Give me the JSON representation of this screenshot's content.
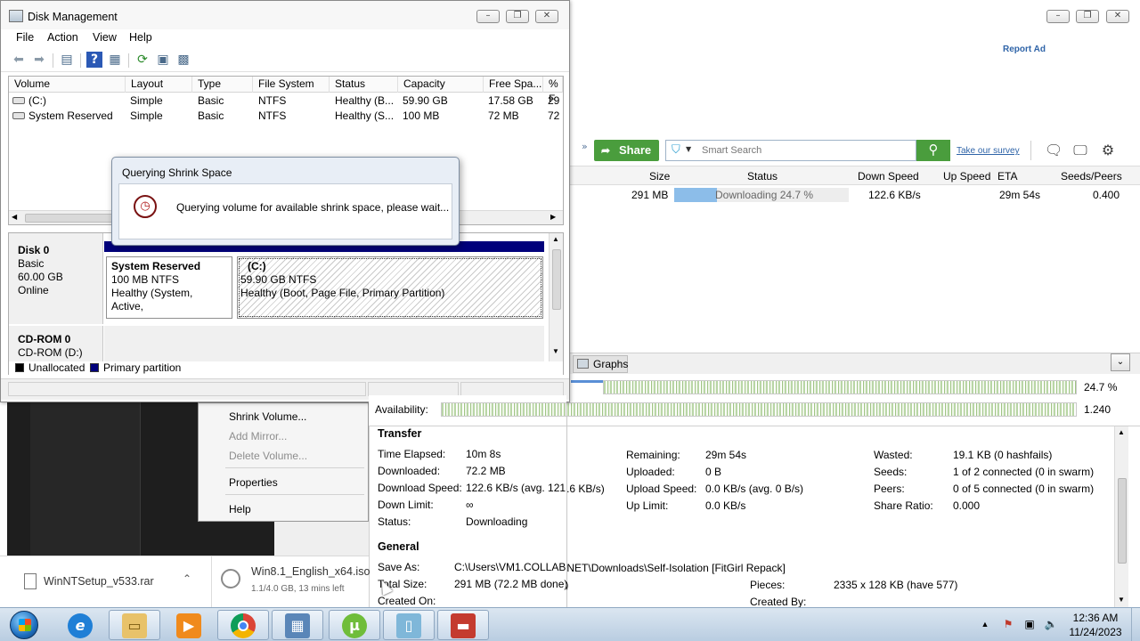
{
  "utorrent": {
    "report_ad": "Report Ad",
    "share_label": "Share",
    "search_placeholder": "Smart Search",
    "survey_link": "Take our survey",
    "columns": {
      "size": "Size",
      "status": "Status",
      "down_speed": "Down Speed",
      "up_speed": "Up Speed",
      "eta": "ETA",
      "seeds_peers": "Seeds/Peers"
    },
    "torrent": {
      "size": "291 MB",
      "status": "Downloading 24.7 %",
      "progress": 0.247,
      "down_speed": "122.6 KB/s",
      "eta": "29m 54s",
      "seeds_peers": "0.400"
    },
    "graphs_tab": "Graphs",
    "piece_percent": "24.7 %",
    "availability_label": "Availability:",
    "availability_value": "1.240",
    "transfer": {
      "heading": "Transfer",
      "time_elapsed_label": "Time Elapsed:",
      "time_elapsed": "10m 8s",
      "downloaded_label": "Downloaded:",
      "downloaded": "72.2 MB",
      "download_speed_label": "Download Speed:",
      "download_speed": "122.6 KB/s (avg. 121.6 KB/s)",
      "down_limit_label": "Down Limit:",
      "down_limit": "∞",
      "status_label": "Status:",
      "status": "Downloading",
      "remaining_label": "Remaining:",
      "remaining": "29m 54s",
      "uploaded_label": "Uploaded:",
      "uploaded": "0 B",
      "upload_speed_label": "Upload Speed:",
      "upload_speed": "0.0 KB/s (avg. 0 B/s)",
      "up_limit_label": "Up Limit:",
      "up_limit": "0.0 KB/s",
      "wasted_label": "Wasted:",
      "wasted": "19.1 KB (0 hashfails)",
      "seeds_label": "Seeds:",
      "seeds": "1 of 2 connected (0 in swarm)",
      "peers_label": "Peers:",
      "peers": "0 of 5 connected (0 in swarm)",
      "share_ratio_label": "Share Ratio:",
      "share_ratio": "0.000"
    },
    "general": {
      "heading": "General",
      "save_as_label": "Save As:",
      "save_as": "C:\\Users\\VM1.COLLABNET\\Downloads\\Self-Isolation [FitGirl Repack]",
      "total_size_label": "Total Size:",
      "total_size": "291 MB (72.2 MB done)",
      "created_on_label": "Created On:",
      "pieces_label": "Pieces:",
      "pieces": "2335 x 128 KB (have 577)",
      "created_by_label": "Created By:"
    }
  },
  "disk_mgmt": {
    "title": "Disk Management",
    "menu": [
      "File",
      "Action",
      "View",
      "Help"
    ],
    "columns": [
      "Volume",
      "Layout",
      "Type",
      "File System",
      "Status",
      "Capacity",
      "Free Spa...",
      "% F"
    ],
    "rows": [
      [
        "(C:)",
        "Simple",
        "Basic",
        "NTFS",
        "Healthy (B...",
        "59.90 GB",
        "17.58 GB",
        "29"
      ],
      [
        "System Reserved",
        "Simple",
        "Basic",
        "NTFS",
        "Healthy (S...",
        "100 MB",
        "72 MB",
        "72"
      ]
    ],
    "disk0": {
      "name": "Disk 0",
      "type": "Basic",
      "size": "60.00 GB",
      "state": "Online"
    },
    "part_sys": {
      "name": "System Reserved",
      "size": "100 MB NTFS",
      "status": "Healthy (System, Active,"
    },
    "part_c": {
      "name": "(C:)",
      "size": "59.90 GB NTFS",
      "status": "Healthy (Boot, Page File, Primary Partition)"
    },
    "cdrom": {
      "name": "CD-ROM 0",
      "drive": "CD-ROM (D:)"
    },
    "legend": {
      "unallocated": "Unallocated",
      "primary": "Primary partition",
      "unallocated_color": "#000000",
      "primary_color": "#00007b"
    }
  },
  "dialog": {
    "title": "Querying Shrink Space",
    "message": "Querying volume for available shrink space, please wait..."
  },
  "context_menu": {
    "shrink": "Shrink Volume...",
    "add_mirror": "Add Mirror...",
    "delete": "Delete Volume...",
    "properties": "Properties",
    "help": "Help"
  },
  "downloads": [
    {
      "name": "WinNTSetup_v533.rar"
    },
    {
      "name": "Win8.1_English_x64.iso",
      "detail": "1.1/4.0 GB, 13 mins left"
    }
  ],
  "tray": {
    "time": "12:36 AM",
    "date": "11/24/2023"
  }
}
